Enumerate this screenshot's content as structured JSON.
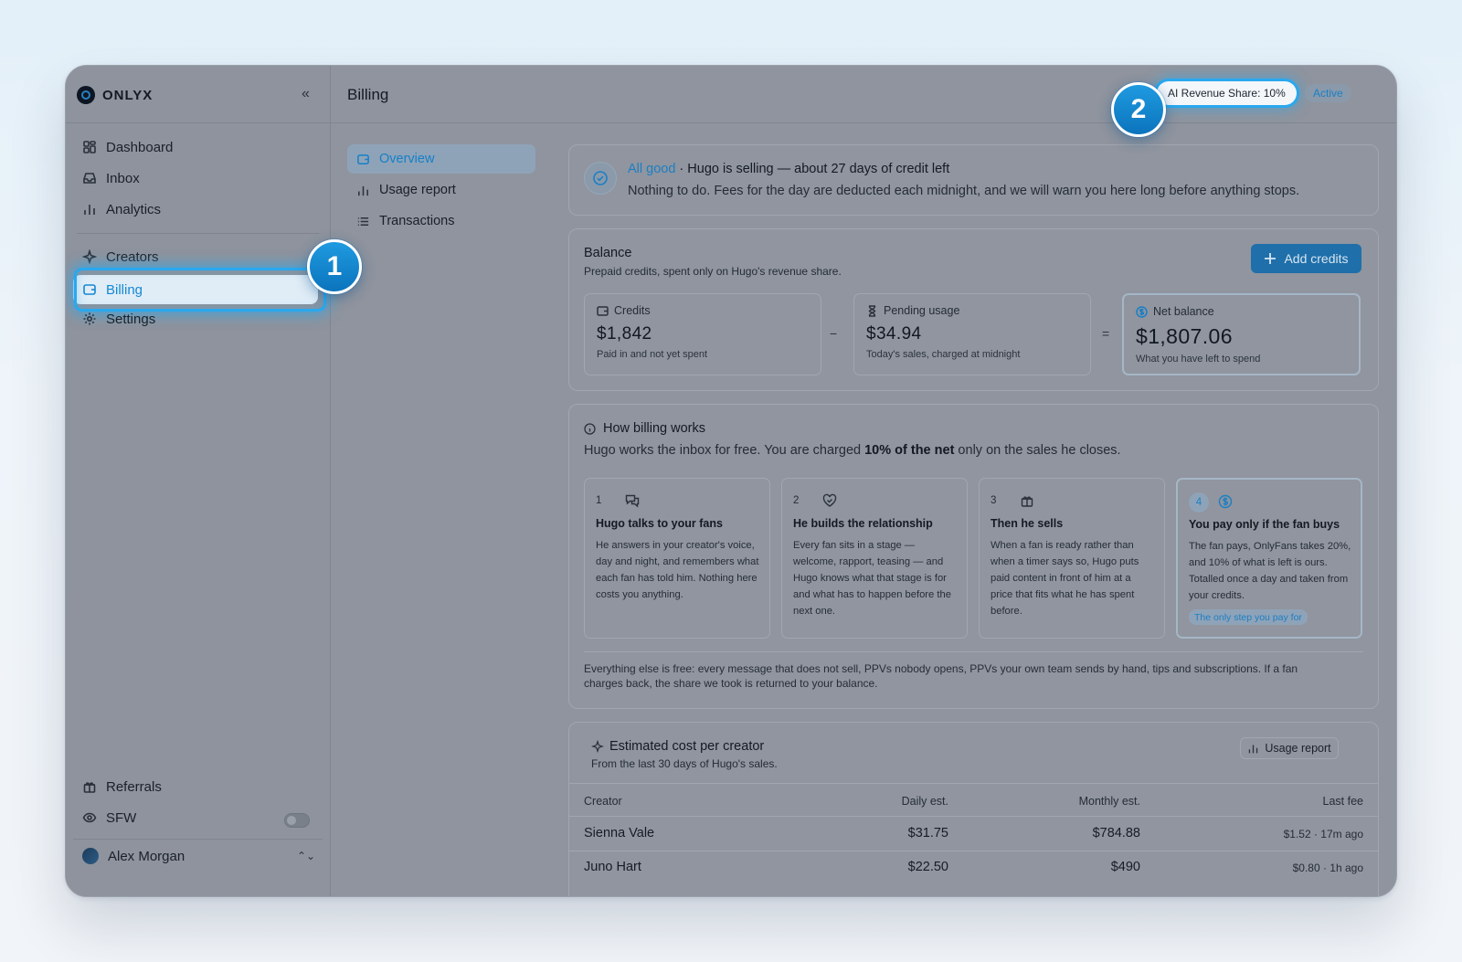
{
  "brand": {
    "name": "ONLYX"
  },
  "sidebar": {
    "collapse_glyph": "«",
    "items": [
      {
        "label": "Dashboard",
        "icon": "dashboard-icon"
      },
      {
        "label": "Inbox",
        "icon": "inbox-icon"
      },
      {
        "label": "Analytics",
        "icon": "analytics-icon"
      },
      {
        "label": "Creators",
        "icon": "sparkle-icon"
      },
      {
        "label": "Billing",
        "icon": "wallet-icon",
        "active": true
      },
      {
        "label": "Settings",
        "icon": "gear-icon"
      }
    ],
    "bottom_items": [
      {
        "label": "Referrals",
        "icon": "gift-icon"
      },
      {
        "label": "SFW",
        "icon": "eye-icon",
        "toggle": false
      }
    ],
    "user": {
      "name": "Alex Morgan"
    }
  },
  "header": {
    "title": "Billing",
    "revenue_pill": "AI Revenue Share: 10%",
    "status_pill": "Active"
  },
  "subnav": {
    "items": [
      {
        "label": "Overview",
        "active": true
      },
      {
        "label": "Usage report"
      },
      {
        "label": "Transactions"
      }
    ]
  },
  "status": {
    "good": "All good",
    "headline": " · Hugo is selling — about 27 days of credit left",
    "detail": "Nothing to do. Fees for the day are deducted each midnight, and we will warn you here long before anything stops."
  },
  "balance": {
    "title": "Balance",
    "subtitle": "Prepaid credits, spent only on Hugo's revenue share.",
    "add_button": "Add credits",
    "minus": "−",
    "equals": "=",
    "credits": {
      "label": "Credits",
      "amount": "$1,842",
      "note": "Paid in and not yet spent"
    },
    "pending": {
      "label": "Pending usage",
      "amount": "$34.94",
      "note": "Today's sales, charged at midnight"
    },
    "net": {
      "label": "Net balance",
      "amount": "$1,807.06",
      "note": "What you have left to spend"
    }
  },
  "how": {
    "title": "How billing works",
    "lead_before": "Hugo works the inbox for free. You are charged ",
    "lead_bold": "10% of the net",
    "lead_after": " only on the sales he closes.",
    "steps": [
      {
        "num": "1",
        "icon": "chat-icon",
        "title": "Hugo talks to your fans",
        "body": "He answers in your creator's voice, day and night, and remembers what each fan has told him. Nothing here costs you anything."
      },
      {
        "num": "2",
        "icon": "heart-handshake-icon",
        "title": "He builds the relationship",
        "body": "Every fan sits in a stage — welcome, rapport, teasing — and Hugo knows what that stage is for and what has to happen before the next one."
      },
      {
        "num": "3",
        "icon": "gift-icon",
        "title": "Then he sells",
        "body": "When a fan is ready rather than when a timer says so, Hugo puts paid content in front of him at a price that fits what he has spent before."
      },
      {
        "num": "4",
        "icon": "dollar-circle-icon",
        "title": "You pay only if the fan buys",
        "body": "The fan pays, OnlyFans takes 20%, and 10% of what is left is ours. Totalled once a day and taken from your credits.",
        "badge": "The only step you pay for"
      }
    ],
    "footer": "Everything else is free: every message that does not sell, PPVs nobody opens, PPVs your own team sends by hand, tips and subscriptions. If a fan charges back, the share we took is returned to your balance."
  },
  "estimate": {
    "title": "Estimated cost per creator",
    "subtitle": "From the last 30 days of Hugo's sales.",
    "button": "Usage report",
    "columns": [
      "Creator",
      "Daily est.",
      "Monthly est.",
      "Last fee"
    ],
    "rows": [
      [
        "Sienna Vale",
        "$31.75",
        "$784.88",
        "$1.52 · 17m ago"
      ],
      [
        "Juno Hart",
        "$22.50",
        "$490",
        "$0.80 · 1h ago"
      ]
    ]
  },
  "markers": [
    "1",
    "2"
  ],
  "colors": {
    "accent": "#1b7fc4",
    "highlight": "#29a8ee",
    "overlay": "#8f949e"
  }
}
